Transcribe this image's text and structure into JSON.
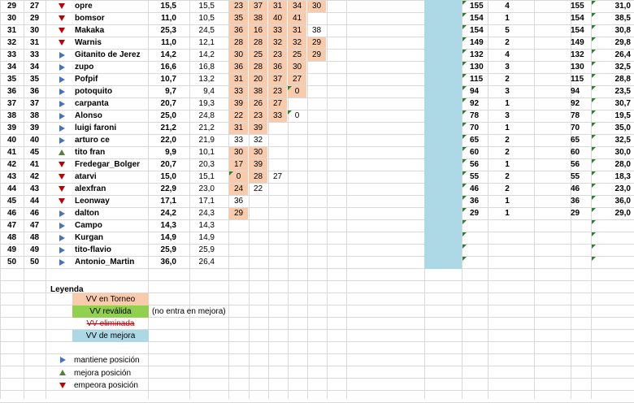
{
  "rows": [
    {
      "rn": "29",
      "pos": "27",
      "arrow": "down",
      "name": "opre",
      "c1": "15,5",
      "c2": "15,5",
      "r": [
        "23",
        "37",
        "31",
        "34",
        "30"
      ],
      "p": [
        0,
        1,
        2,
        3,
        4
      ],
      "x": "155",
      "y": "4",
      "z": "155",
      "w": "31,0"
    },
    {
      "rn": "30",
      "pos": "29",
      "arrow": "down",
      "name": "bomsor",
      "c1": "11,0",
      "c2": "10,5",
      "r": [
        "35",
        "38",
        "40",
        "41"
      ],
      "p": [
        0,
        1,
        2,
        3
      ],
      "x": "154",
      "y": "1",
      "z": "154",
      "w": "38,5"
    },
    {
      "rn": "31",
      "pos": "30",
      "arrow": "down",
      "name": "Makaka",
      "c1": "25,3",
      "c2": "24,5",
      "r": [
        "36",
        "16",
        "33",
        "31",
        "38"
      ],
      "p": [
        0,
        1,
        2,
        3
      ],
      "x": "154",
      "y": "5",
      "z": "154",
      "w": "30,8"
    },
    {
      "rn": "32",
      "pos": "31",
      "arrow": "down",
      "name": "Warnis",
      "c1": "11,0",
      "c2": "12,1",
      "r": [
        "28",
        "28",
        "32",
        "32",
        "29"
      ],
      "p": [
        0,
        1,
        2,
        3,
        4
      ],
      "x": "149",
      "y": "2",
      "z": "149",
      "w": "29,8"
    },
    {
      "rn": "33",
      "pos": "33",
      "arrow": "right",
      "name": "Gitanito de Jerez",
      "c1": "14,2",
      "c2": "14,2",
      "r": [
        "30",
        "25",
        "23",
        "25",
        "29"
      ],
      "p": [
        0,
        1,
        2,
        3,
        4
      ],
      "x": "132",
      "y": "4",
      "z": "132",
      "w": "26,4"
    },
    {
      "rn": "34",
      "pos": "34",
      "arrow": "right",
      "name": "zupo",
      "c1": "16,6",
      "c2": "16,8",
      "r": [
        "36",
        "28",
        "36",
        "30"
      ],
      "p": [
        0,
        1,
        2,
        3
      ],
      "x": "130",
      "y": "3",
      "z": "130",
      "w": "32,5"
    },
    {
      "rn": "35",
      "pos": "35",
      "arrow": "right",
      "name": "Pofpif",
      "c1": "10,7",
      "c2": "13,2",
      "r": [
        "31",
        "20",
        "37",
        "27"
      ],
      "p": [
        0,
        1,
        2,
        3
      ],
      "x": "115",
      "y": "2",
      "z": "115",
      "w": "28,8"
    },
    {
      "rn": "36",
      "pos": "36",
      "arrow": "right",
      "name": "potoquito",
      "c1": "9,7",
      "c2": "9,4",
      "r": [
        "33",
        "38",
        "23",
        "0"
      ],
      "p": [
        0,
        1,
        2,
        3
      ],
      "x": "94",
      "y": "3",
      "z": "94",
      "w": "23,5"
    },
    {
      "rn": "37",
      "pos": "37",
      "arrow": "right",
      "name": "carpanta",
      "c1": "20,7",
      "c2": "19,3",
      "r": [
        "39",
        "26",
        "27"
      ],
      "p": [
        0,
        1,
        2
      ],
      "x": "92",
      "y": "1",
      "z": "92",
      "w": "30,7"
    },
    {
      "rn": "38",
      "pos": "38",
      "arrow": "right",
      "name": "Alonso",
      "c1": "25,0",
      "c2": "24,8",
      "r": [
        "22",
        "23",
        "33",
        "0"
      ],
      "p": [
        0,
        1,
        2
      ],
      "x": "78",
      "y": "3",
      "z": "78",
      "w": "19,5"
    },
    {
      "rn": "39",
      "pos": "39",
      "arrow": "right",
      "name": "luigi faroni",
      "c1": "21,2",
      "c2": "21,2",
      "r": [
        "31",
        "39"
      ],
      "p": [
        0,
        1
      ],
      "x": "70",
      "y": "1",
      "z": "70",
      "w": "35,0"
    },
    {
      "rn": "40",
      "pos": "40",
      "arrow": "right",
      "name": "arturo ce",
      "c1": "22,0",
      "c2": "21,9",
      "r": [
        "33",
        "32"
      ],
      "p": [],
      "x": "65",
      "y": "2",
      "z": "65",
      "w": "32,5"
    },
    {
      "rn": "41",
      "pos": "45",
      "arrow": "up",
      "name": "tito fran",
      "c1": "9,9",
      "c2": "10,1",
      "r": [
        "30",
        "30"
      ],
      "p": [
        0,
        1
      ],
      "x": "60",
      "y": "2",
      "z": "60",
      "w": "30,0"
    },
    {
      "rn": "42",
      "pos": "41",
      "arrow": "down",
      "name": "Fredegar_Bolger",
      "c1": "20,7",
      "c2": "20,3",
      "r": [
        "17",
        "39"
      ],
      "p": [
        0,
        1
      ],
      "x": "56",
      "y": "1",
      "z": "56",
      "w": "28,0"
    },
    {
      "rn": "43",
      "pos": "42",
      "arrow": "down",
      "name": "atarvi",
      "c1": "15,0",
      "c2": "15,1",
      "r": [
        "0",
        "28",
        "27"
      ],
      "p": [
        0,
        1
      ],
      "x": "55",
      "y": "2",
      "z": "55",
      "w": "18,3"
    },
    {
      "rn": "44",
      "pos": "43",
      "arrow": "down",
      "name": "alexfran",
      "c1": "22,9",
      "c2": "23,0",
      "r": [
        "24",
        "22"
      ],
      "p": [
        0
      ],
      "x": "46",
      "y": "2",
      "z": "46",
      "w": "23,0"
    },
    {
      "rn": "45",
      "pos": "44",
      "arrow": "down",
      "name": "Leonway",
      "c1": "17,1",
      "c2": "17,1",
      "r": [
        "36"
      ],
      "p": [],
      "x": "36",
      "y": "1",
      "z": "36",
      "w": "36,0"
    },
    {
      "rn": "46",
      "pos": "46",
      "arrow": "right",
      "name": "dalton",
      "c1": "24,2",
      "c2": "24,3",
      "r": [
        "29"
      ],
      "p": [
        0
      ],
      "x": "29",
      "y": "1",
      "z": "29",
      "w": "29,0"
    },
    {
      "rn": "47",
      "pos": "47",
      "arrow": "right",
      "name": "Campo",
      "c1": "14,3",
      "c2": "14,3",
      "r": [],
      "p": [],
      "x": "",
      "y": "",
      "z": "",
      "w": ""
    },
    {
      "rn": "48",
      "pos": "48",
      "arrow": "right",
      "name": "Kurgan",
      "c1": "14,9",
      "c2": "14,9",
      "r": [],
      "p": [],
      "x": "",
      "y": "",
      "z": "",
      "w": ""
    },
    {
      "rn": "49",
      "pos": "49",
      "arrow": "right",
      "name": "tito-flavio",
      "c1": "25,9",
      "c2": "25,9",
      "r": [],
      "p": [],
      "x": "",
      "y": "",
      "z": "",
      "w": ""
    },
    {
      "rn": "50",
      "pos": "50",
      "arrow": "right",
      "name": "Antonio_Martin",
      "c1": "36,0",
      "c2": "26,4",
      "r": [],
      "p": [],
      "x": "",
      "y": "",
      "z": "",
      "w": ""
    }
  ],
  "legend": {
    "title": "Leyenda",
    "torneo": "VV en Torneo",
    "revalida": "VV reválida",
    "no_entra": "(no entra en mejora)",
    "eliminada": "VV eliminada",
    "mejora": "VV de mejora",
    "mantiene": "mantiene posición",
    "mejora_pos": "mejora posición",
    "empeora": "empeora posición"
  },
  "colors": {
    "peach": "#f8cbad",
    "green": "#92d050",
    "blue": "#add8e6",
    "red": "#c00000",
    "arrow_blue": "#4472c4",
    "arrow_green": "#548235"
  }
}
